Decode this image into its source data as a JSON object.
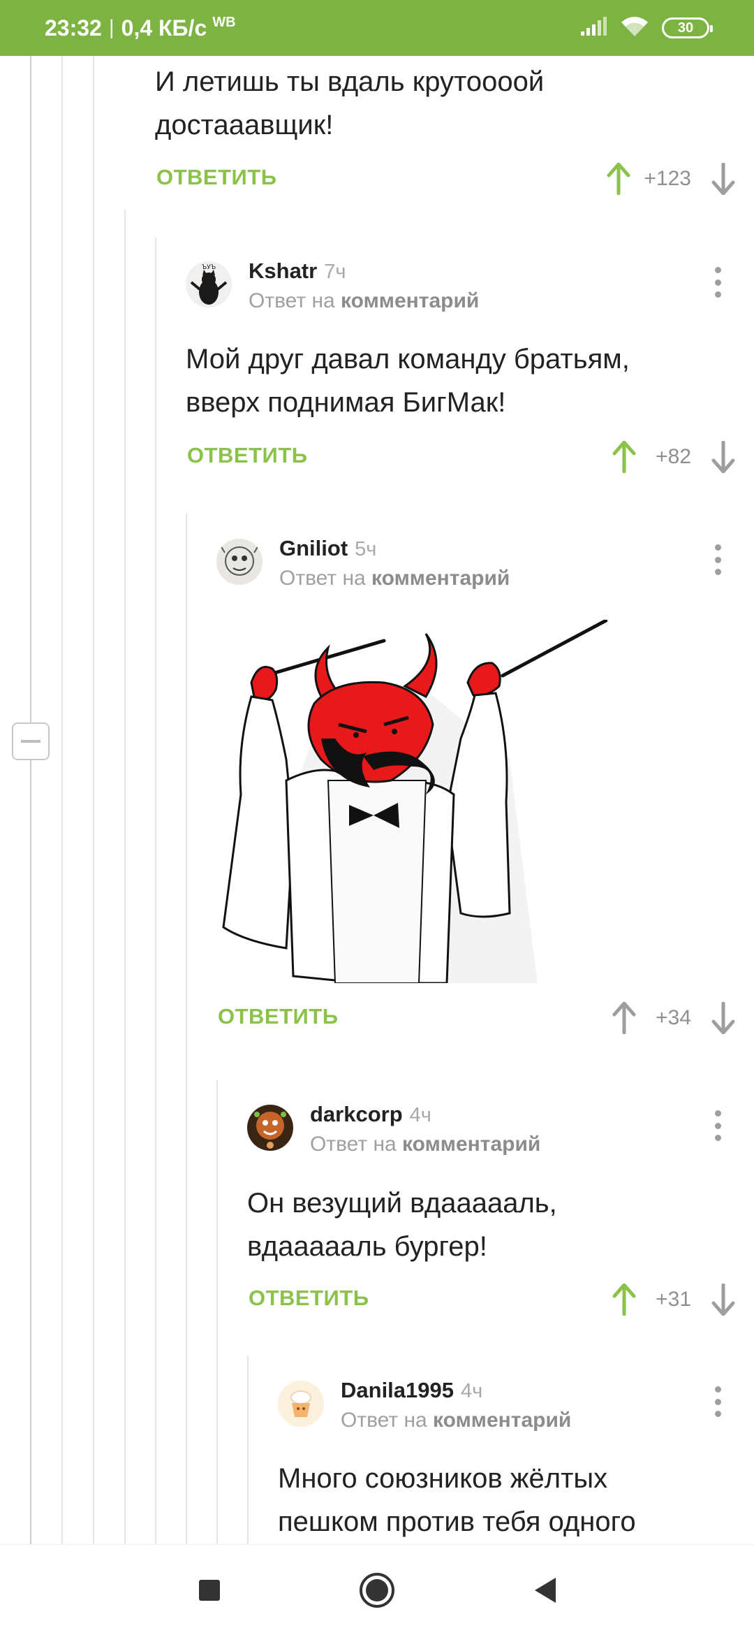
{
  "status_bar": {
    "time": "23:32",
    "separator": "|",
    "speed": "0,4 КБ/с",
    "carrier_badge": "WB",
    "battery": "30",
    "accent_color": "#7cb342"
  },
  "comments": [
    {
      "text": "И летишь ты вдаль крутоооой\nдостааавщик!",
      "reply_label": "ОТВЕТИТЬ",
      "score": "+123",
      "voted_up": true
    },
    {
      "author": "Kshatr",
      "time": "7ч",
      "reply_prefix": "Ответ на",
      "reply_target": "комментарий",
      "text": "Мой друг давал команду братьям,\nвверх поднимая БигМак!",
      "reply_label": "ОТВЕТИТЬ",
      "score": "+82",
      "voted_up": true,
      "avatar_icon": "black-cat-avatar-icon",
      "avatar_text": "ЪУЪ"
    },
    {
      "author": "Gniliot",
      "time": "5ч",
      "reply_prefix": "Ответ на",
      "reply_target": "комментарий",
      "image_description_icon": "devil-conductor-image",
      "reply_label": "ОТВЕТИТЬ",
      "score": "+34",
      "voted_up": false,
      "avatar_icon": "sketch-creature-avatar-icon"
    },
    {
      "author": "darkcorp",
      "time": "4ч",
      "reply_prefix": "Ответ на",
      "reply_target": "комментарий",
      "text": "Он везущий вдаааааль,\nвдаааааль бургер!",
      "reply_label": "ОТВЕТИТЬ",
      "score": "+31",
      "voted_up": true,
      "avatar_icon": "gingerbread-avatar-icon"
    },
    {
      "author": "Danila1995",
      "time": "4ч",
      "reply_prefix": "Ответ на",
      "reply_target": "комментарий",
      "text": "Много союзников жёлтых\nпешком против тебя одного",
      "avatar_icon": "cupcake-avatar-icon"
    }
  ],
  "nav": {
    "recents_icon": "square-icon",
    "home_icon": "circle-icon",
    "back_icon": "triangle-back-icon"
  },
  "colors": {
    "reply_green": "#8bc34a",
    "upvote_active": "#8bc34a",
    "vote_inactive": "#9e9e9e"
  }
}
